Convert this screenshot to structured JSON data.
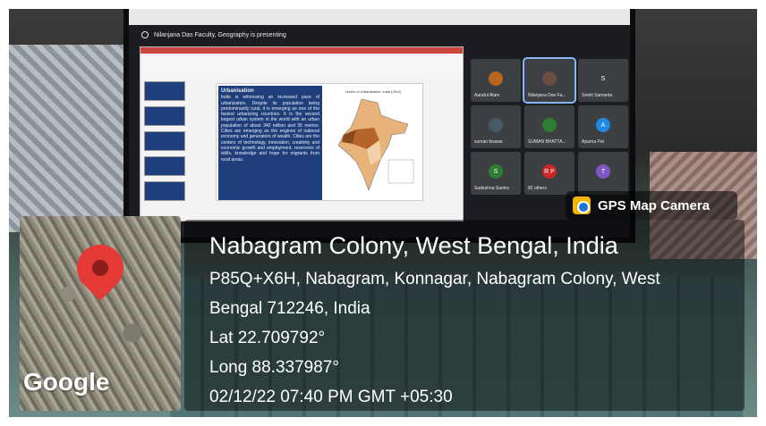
{
  "meet": {
    "presenting": "Nilanjana Das Faculty, Geography is presenting",
    "participants": [
      {
        "name": "Aaraful Alam",
        "initial": "",
        "color": "#b5651d",
        "active": false
      },
      {
        "name": "Nilanjana Das Fa...",
        "initial": "",
        "color": "#6d4c41",
        "active": true
      },
      {
        "name": "Smriti Samanta",
        "initial": "S",
        "color": "#3c4043",
        "active": false
      },
      {
        "name": "suman biswas",
        "initial": "",
        "color": "#455a64",
        "active": false
      },
      {
        "name": "SUMAN BHATTA...",
        "initial": "",
        "color": "#2e7d32",
        "active": false
      },
      {
        "name": "Aparna Pal",
        "initial": "A",
        "color": "#1e88e5",
        "active": false
      },
      {
        "name": "Sudeshna Santra",
        "initial": "S",
        "color": "#2e7d32",
        "active": false
      },
      {
        "name": "82 others",
        "initial": "R P",
        "color": "#c62828",
        "active": false
      },
      {
        "name": "",
        "initial": "T",
        "color": "#7e57c2",
        "active": false
      }
    ]
  },
  "slide": {
    "heading": "Urbanisation",
    "body": "India is witnessing an increased pace of urbanization. Despite its population being predominantly rural, it is emerging as one of the fastest urbanizing countries. It is the second largest urban system in the world with an urban population of about 340 million and 35 metros. Cities are emerging as the engines of national economy and generators of wealth. Cities are the centers of technology, innovation, creativity and economic growth and employment, reservoirs of skills, knowledge and hope for migrants from rural areas.",
    "map_title": "Levels of Urbanisation, India (2011)"
  },
  "gps": {
    "app_name": "GPS Map Camera",
    "logo_text": "Google",
    "place": "Nabagram Colony, West Bengal, India",
    "address_line1": "P85Q+X6H, Nabagram, Konnagar, Nabagram Colony, West",
    "address_line2": "Bengal 712246, India",
    "lat": "Lat 22.709792°",
    "long": "Long 88.337987°",
    "datetime": "02/12/22 07:40 PM GMT +05:30"
  }
}
